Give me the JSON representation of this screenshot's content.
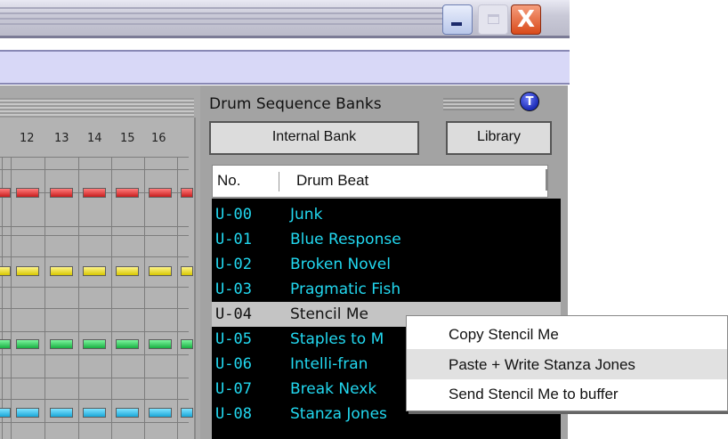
{
  "window": {
    "minimize_glyph": "_",
    "maximize_glyph": "□",
    "close_glyph": "X"
  },
  "grid": {
    "step_numbers": [
      "12",
      "13",
      "14",
      "15",
      "16"
    ],
    "led_colors": [
      "red",
      "yellow",
      "green",
      "blue"
    ]
  },
  "bank": {
    "title": "Drum Sequence Banks",
    "info_badge": "T",
    "internal_bank_label": "Internal Bank",
    "library_label": "Library",
    "columns": {
      "no": "No.",
      "drum_beat": "Drum Beat"
    },
    "rows": [
      {
        "no": "U-00",
        "name": "Junk"
      },
      {
        "no": "U-01",
        "name": "Blue Response"
      },
      {
        "no": "U-02",
        "name": "Broken Novel"
      },
      {
        "no": "U-03",
        "name": "Pragmatic Fish"
      },
      {
        "no": "U-04",
        "name": "Stencil Me"
      },
      {
        "no": "U-05",
        "name": "Staples to M"
      },
      {
        "no": "U-06",
        "name": "Intelli-fran"
      },
      {
        "no": "U-07",
        "name": "Break Nexk"
      },
      {
        "no": "U-08",
        "name": "Stanza Jones"
      }
    ],
    "selected_row_index": 4
  },
  "context_menu": {
    "items": [
      {
        "label": "Copy Stencil Me"
      },
      {
        "label": "Paste + Write Stanza Jones"
      },
      {
        "label": "Send Stencil Me to buffer"
      }
    ],
    "highlighted_index": 1
  }
}
